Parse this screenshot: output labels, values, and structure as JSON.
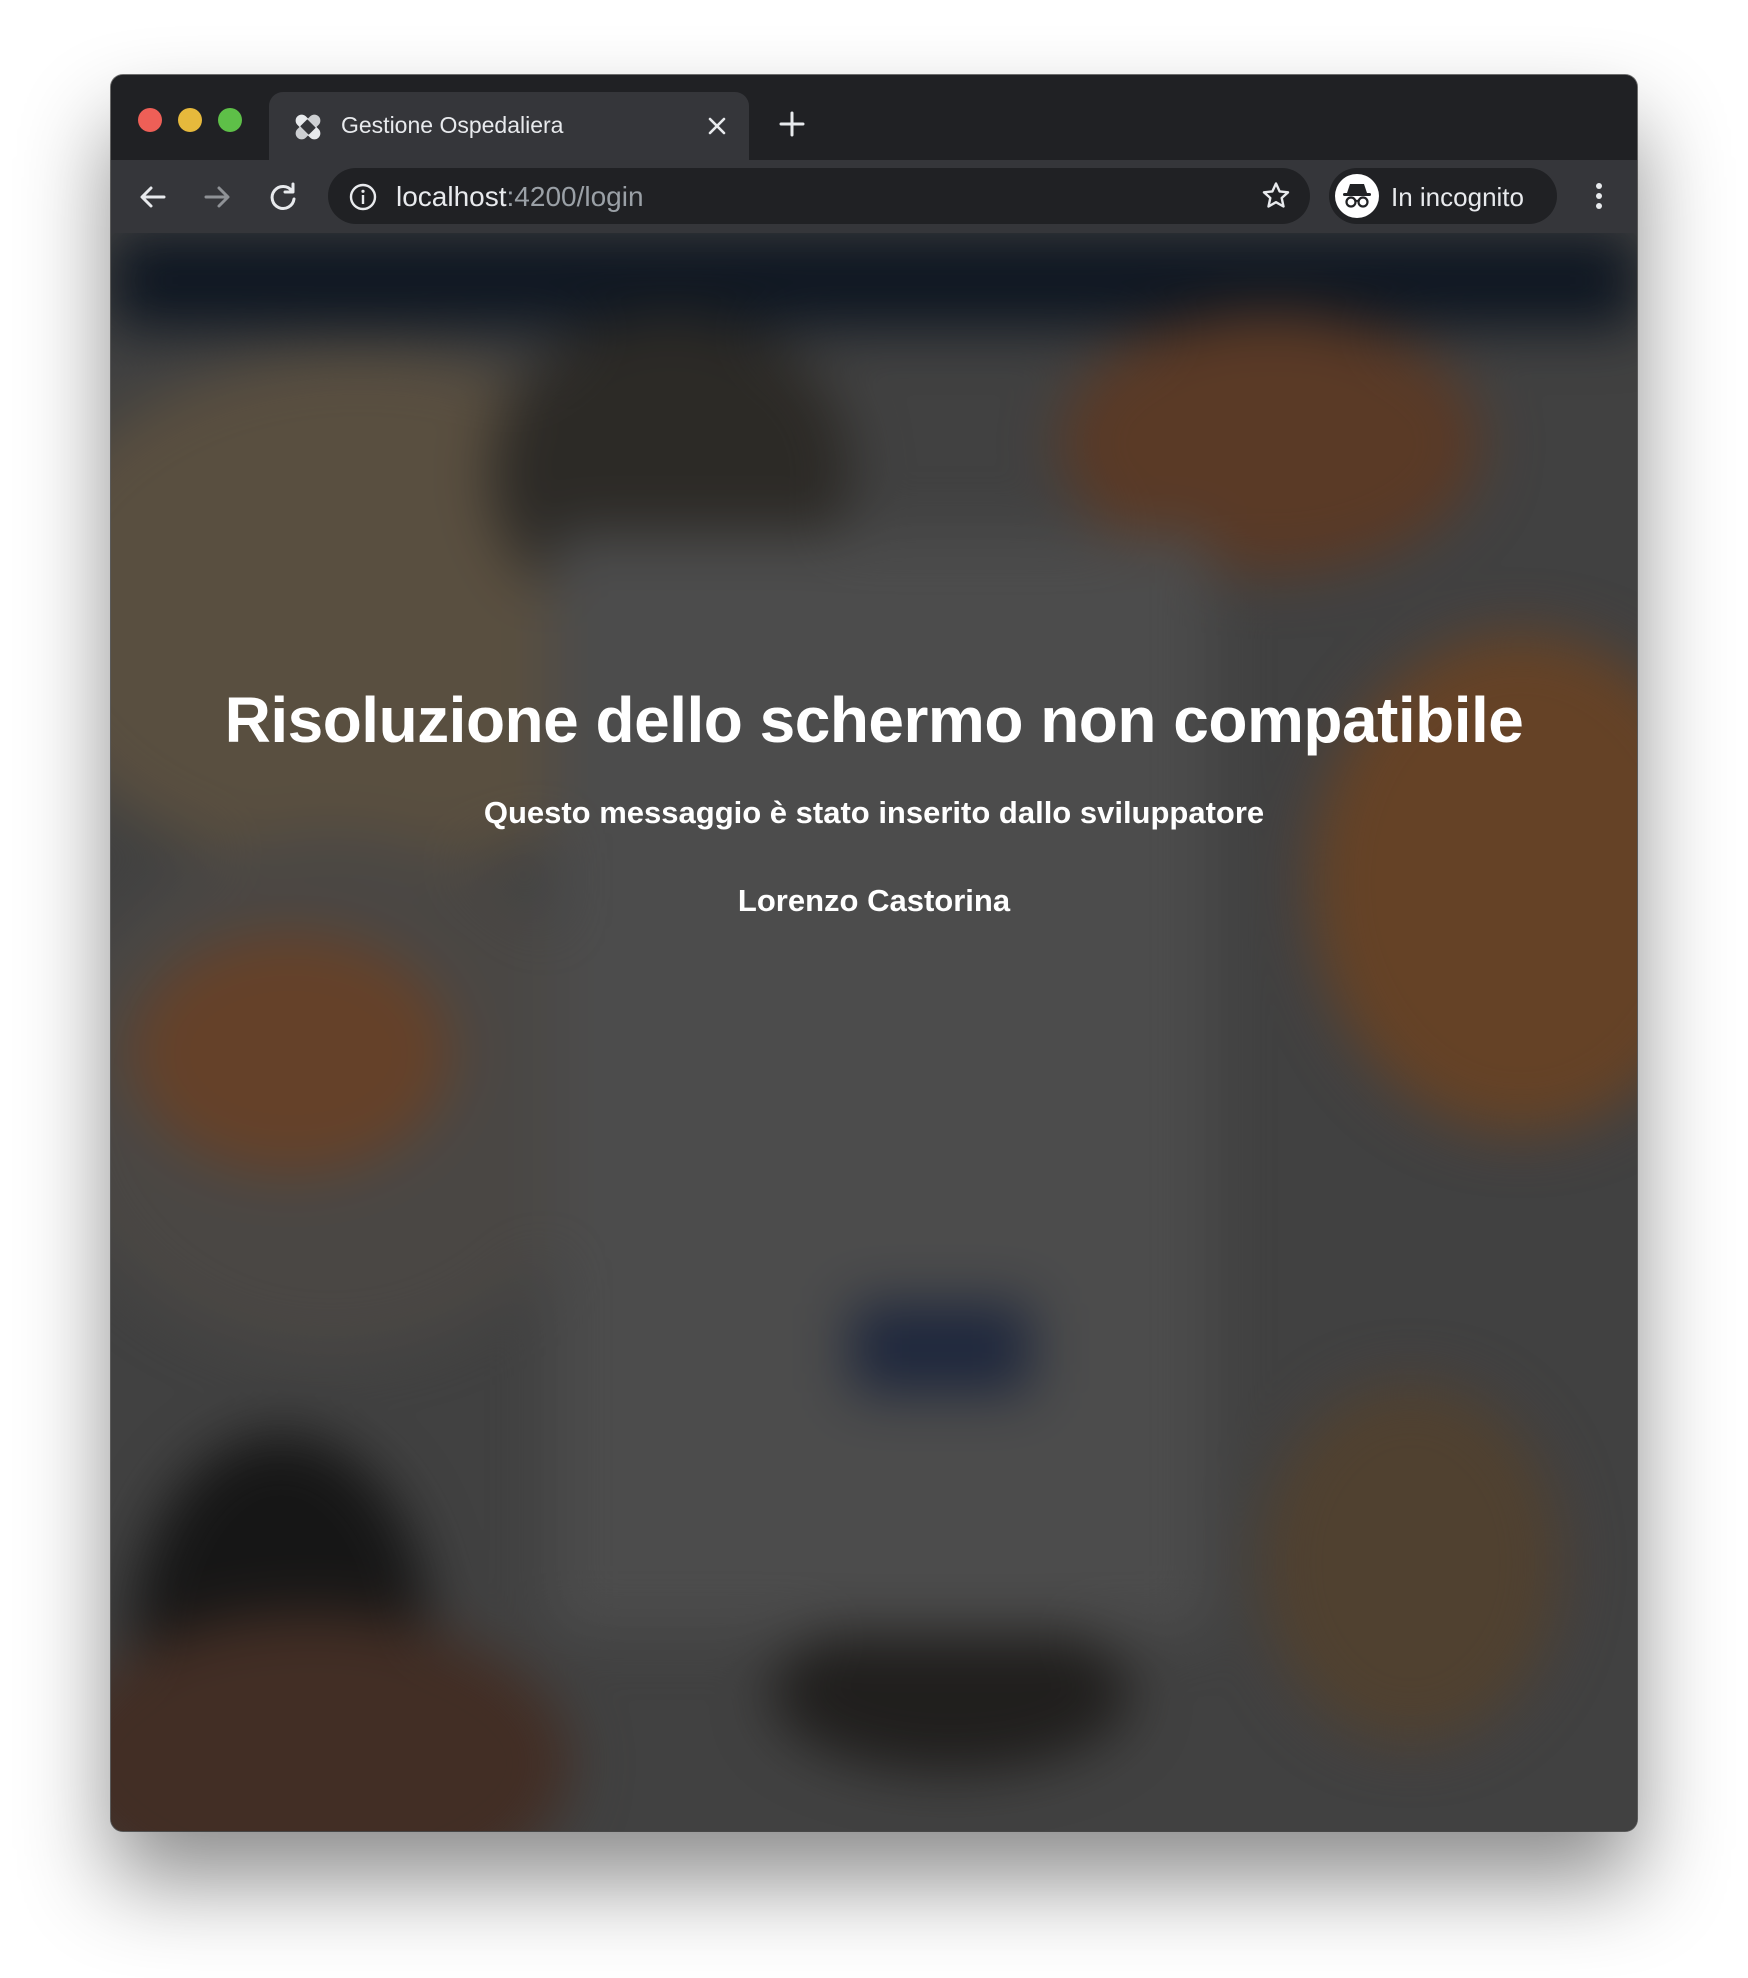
{
  "browser": {
    "tab": {
      "title": "Gestione Ospedaliera",
      "favicon": "bandage-icon"
    },
    "address_bar": {
      "host": "localhost",
      "path": ":4200/login"
    },
    "profile": {
      "label": "In incognito",
      "icon": "incognito-icon"
    },
    "colors": {
      "frame": "#202124",
      "toolbar": "#35363a",
      "traffic_red": "#ee5f57",
      "traffic_yellow": "#e6b93c",
      "traffic_green": "#5ec048"
    }
  },
  "page": {
    "title": "Risoluzione dello schermo non compatibile",
    "subtitle": "Questo messaggio è stato inserito dallo sviluppatore",
    "author": "Lorenzo Castorina"
  }
}
